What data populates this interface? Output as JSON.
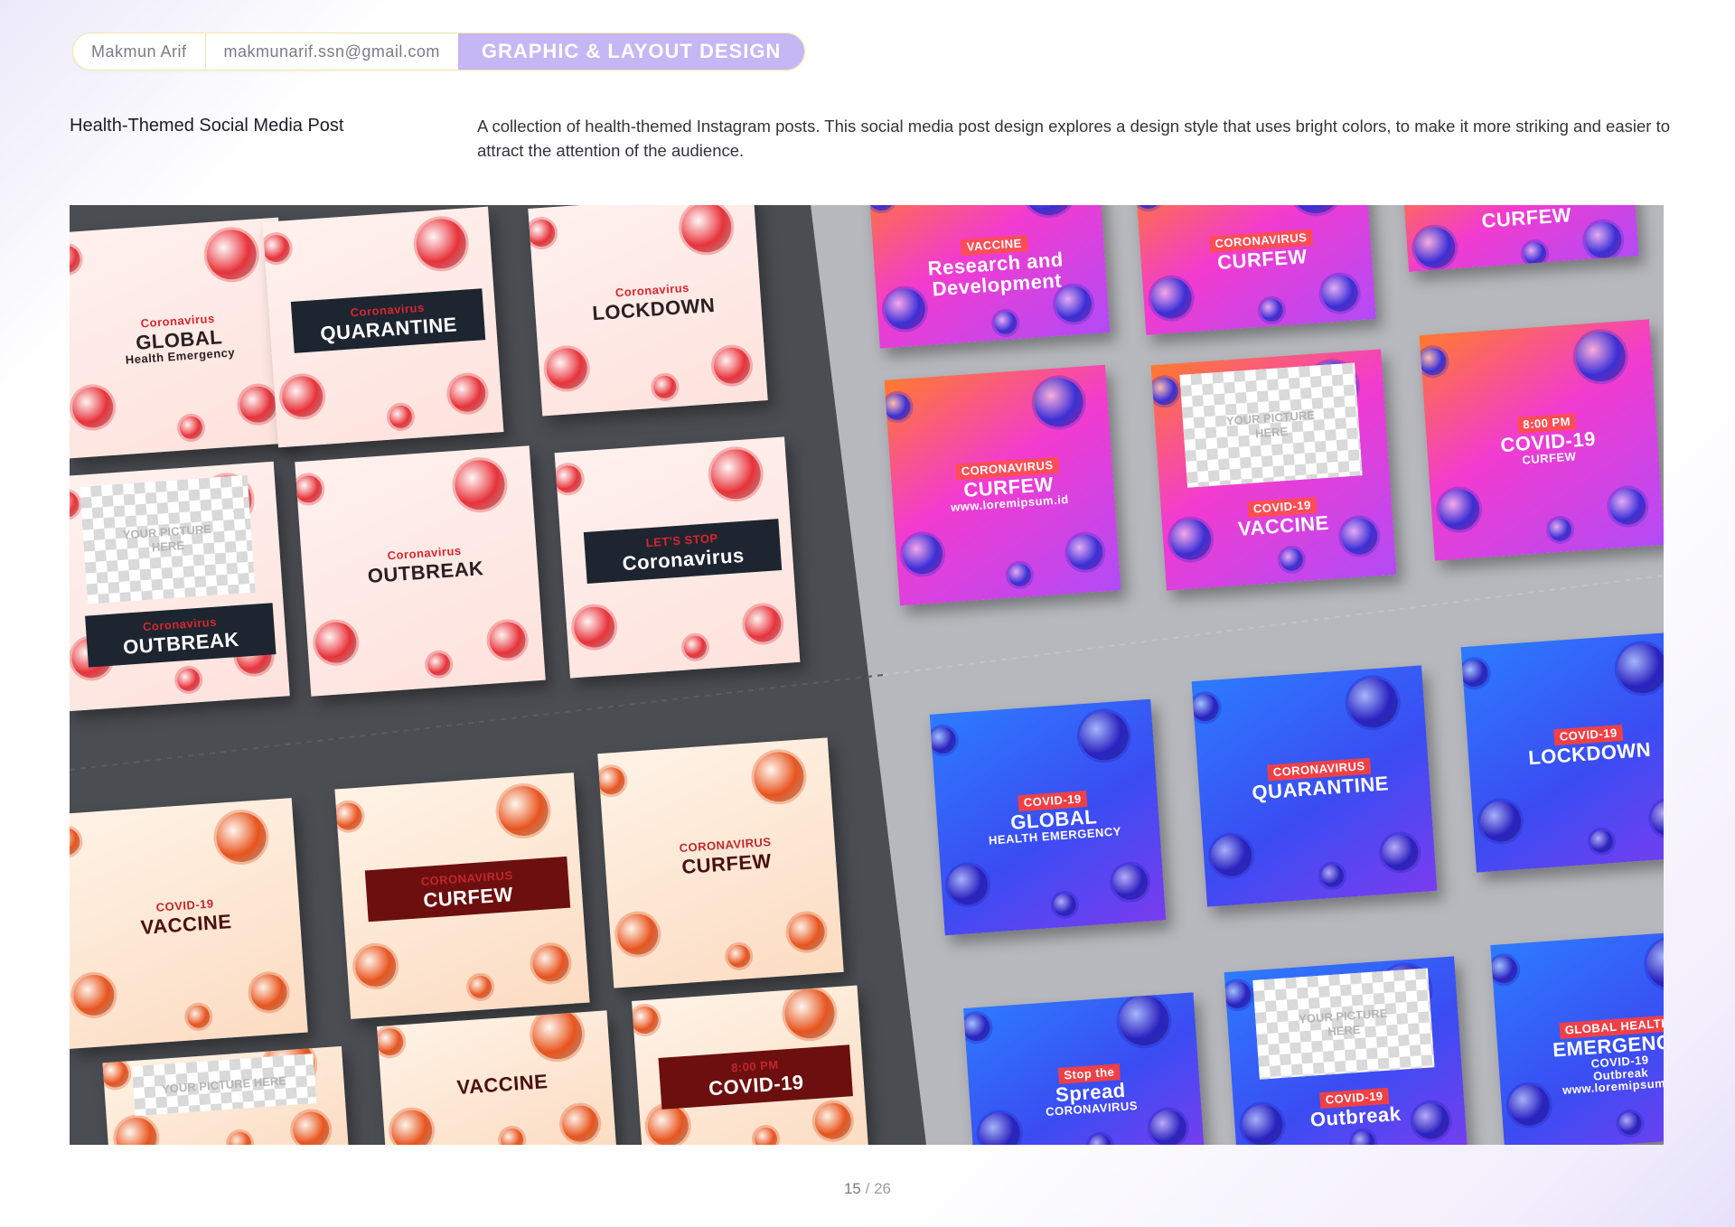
{
  "header": {
    "author_name": "Makmun Arif",
    "email": "makmunarif.ssn@gmail.com",
    "category": "GRAPHIC & LAYOUT DESIGN"
  },
  "section": {
    "title": "Health-Themed Social Media Post",
    "description": "A collection of health-themed Instagram posts. This social media post design explores a design style that uses bright colors, to make it more striking and easier to attract the attention of the audience."
  },
  "colors": {
    "accent": "#c4b7f3",
    "dark_panel": "#4a4d52",
    "light_panel": "#b7b8bd",
    "red_virus": "#e8323a",
    "blue_virus": "#3b2fd6",
    "magenta": "#e63bd8"
  },
  "cards": [
    {
      "theme": "red",
      "lines": [
        "Coronavirus",
        "GLOBAL",
        "Health Emergency"
      ]
    },
    {
      "theme": "red",
      "lines": [
        "Coronavirus",
        "QUARANTINE"
      ]
    },
    {
      "theme": "red",
      "lines": [
        "Coronavirus",
        "LOCKDOWN"
      ]
    },
    {
      "theme": "red",
      "lines": [
        "Coronavirus",
        "OUTBREAK"
      ],
      "placeholder": "YOUR PICTURE HERE"
    },
    {
      "theme": "red",
      "lines": [
        "Coronavirus",
        "OUTBREAK"
      ]
    },
    {
      "theme": "red",
      "lines": [
        "LET'S STOP",
        "Coronavirus"
      ]
    },
    {
      "theme": "orange",
      "lines": [
        "COVID-19",
        "VACCINE"
      ]
    },
    {
      "theme": "orange",
      "lines": [
        "CORONAVIRUS",
        "CURFEW"
      ]
    },
    {
      "theme": "orange",
      "lines": [
        "CORONAVIRUS",
        "CURFEW"
      ]
    },
    {
      "theme": "orange",
      "lines": [],
      "placeholder": "YOUR PICTURE HERE"
    },
    {
      "theme": "orange",
      "lines": [
        "VACCINE"
      ]
    },
    {
      "theme": "orange",
      "lines": [
        "8:00 PM",
        "COVID-19"
      ]
    },
    {
      "theme": "magenta",
      "lines": [
        "VACCINE",
        "Research and Development"
      ]
    },
    {
      "theme": "magenta",
      "lines": [
        "CORONAVIRUS",
        "CURFEW"
      ]
    },
    {
      "theme": "magenta",
      "lines": [
        "CURFEW"
      ]
    },
    {
      "theme": "magenta",
      "lines": [
        "CORONAVIRUS",
        "CURFEW",
        "www.loremipsum.id"
      ]
    },
    {
      "theme": "magenta",
      "lines": [
        "COVID-19",
        "VACCINE"
      ],
      "placeholder": "YOUR PICTURE HERE"
    },
    {
      "theme": "magenta",
      "lines": [
        "8:00 PM",
        "COVID-19",
        "CURFEW"
      ]
    },
    {
      "theme": "blue",
      "lines": [
        "COVID-19",
        "GLOBAL",
        "HEALTH EMERGENCY"
      ]
    },
    {
      "theme": "blue",
      "lines": [
        "CORONAVIRUS",
        "QUARANTINE"
      ]
    },
    {
      "theme": "blue",
      "lines": [
        "COVID-19",
        "LOCKDOWN"
      ]
    },
    {
      "theme": "blue",
      "lines": [
        "Stop the",
        "Spread",
        "CORONAVIRUS"
      ]
    },
    {
      "theme": "blue",
      "lines": [
        "COVID-19",
        "Outbreak"
      ],
      "placeholder": "YOUR PICTURE HERE"
    },
    {
      "theme": "blue",
      "lines": [
        "GLOBAL HEALTH",
        "EMERGENCY",
        "COVID-19",
        "Outbreak",
        "www.loremipsum.id"
      ]
    }
  ],
  "pagination": {
    "current": "15",
    "separator": "/",
    "total": "26"
  }
}
